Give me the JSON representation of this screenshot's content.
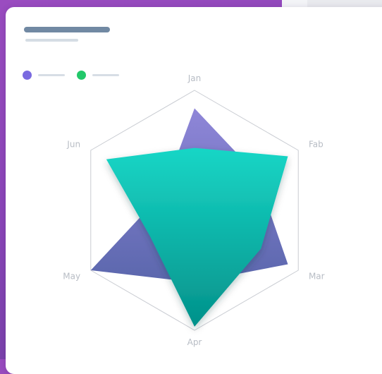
{
  "chart_data": {
    "type": "radar",
    "categories": [
      "Jan",
      "Fab",
      "Mar",
      "Apr",
      "May",
      "Jun"
    ],
    "max": 100,
    "series": [
      {
        "color": "#6a66c2",
        "values": [
          85,
          60,
          90,
          60,
          100,
          30
        ]
      },
      {
        "color": "#12c2b4",
        "values": [
          52,
          90,
          64,
          97,
          43,
          85
        ]
      }
    ],
    "grid": true
  },
  "legend": {
    "items": [
      {
        "color": "#7a6ae0"
      },
      {
        "color": "#22c86a"
      }
    ]
  }
}
